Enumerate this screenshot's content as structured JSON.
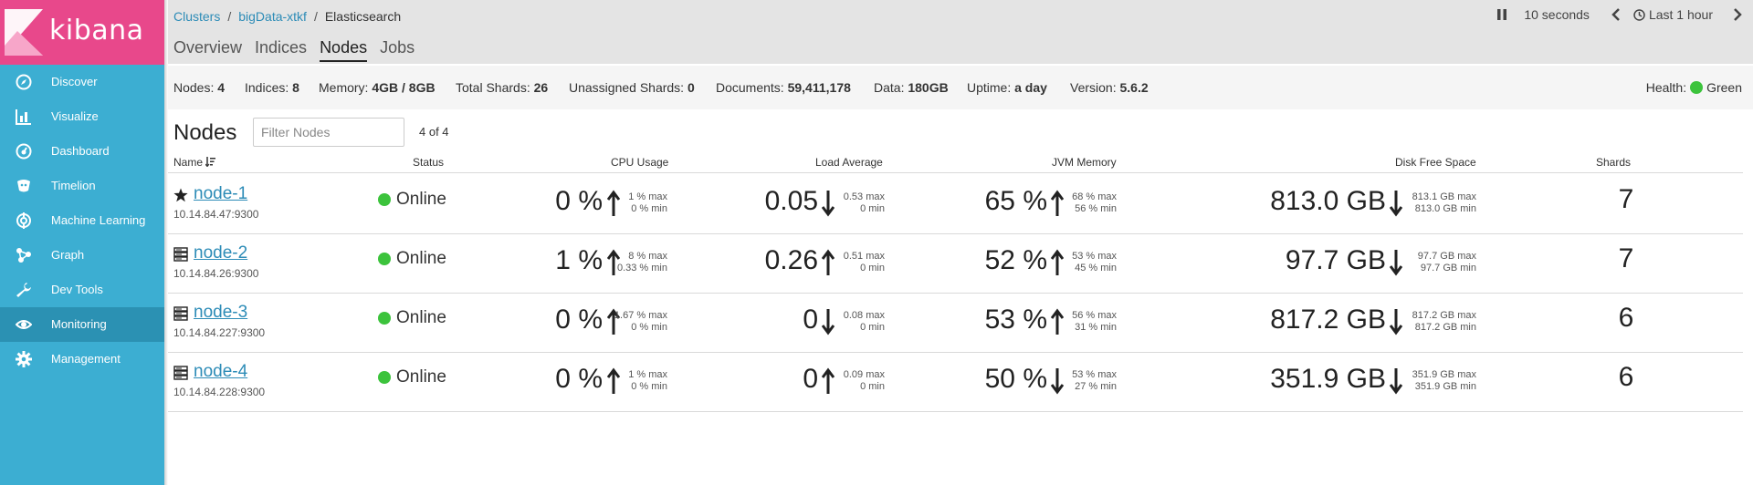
{
  "app": {
    "name": "kibana"
  },
  "sidebar": {
    "items": [
      {
        "label": "Discover",
        "icon": "compass-icon"
      },
      {
        "label": "Visualize",
        "icon": "bar-chart-icon"
      },
      {
        "label": "Dashboard",
        "icon": "dashboard-icon"
      },
      {
        "label": "Timelion",
        "icon": "timelion-icon"
      },
      {
        "label": "Machine Learning",
        "icon": "ml-icon"
      },
      {
        "label": "Graph",
        "icon": "graph-icon"
      },
      {
        "label": "Dev Tools",
        "icon": "wrench-icon"
      },
      {
        "label": "Monitoring",
        "icon": "eye-icon",
        "active": true
      },
      {
        "label": "Management",
        "icon": "gear-icon"
      }
    ]
  },
  "breadcrumb": {
    "root": "Clusters",
    "cluster": "bigData-xtkf",
    "current": "Elasticsearch",
    "sep": "/"
  },
  "tabs": [
    "Overview",
    "Indices",
    "Nodes",
    "Jobs"
  ],
  "time": {
    "interval": "10 seconds",
    "range": "Last 1 hour"
  },
  "summary": {
    "nodes_label": "Nodes:",
    "nodes": "4",
    "indices_label": "Indices:",
    "indices": "8",
    "memory_label": "Memory:",
    "memory": "4GB / 8GB",
    "shards_label": "Total Shards:",
    "shards": "26",
    "unassigned_label": "Unassigned Shards:",
    "unassigned": "0",
    "documents_label": "Documents:",
    "documents": "59,411,178",
    "data_label": "Data:",
    "data": "180GB",
    "uptime_label": "Uptime:",
    "uptime": "a day",
    "version_label": "Version:",
    "version": "5.6.2",
    "health_label": "Health:",
    "health": "Green"
  },
  "nodes_panel": {
    "title": "Nodes",
    "filter_placeholder": "Filter Nodes",
    "count": "4 of 4",
    "columns": {
      "name": "Name",
      "status": "Status",
      "cpu": "CPU Usage",
      "load": "Load Average",
      "jvm": "JVM Memory",
      "disk": "Disk Free Space",
      "shards": "Shards"
    },
    "rows": [
      {
        "name": "node-1",
        "ip": "10.14.84.47:9300",
        "icon": "star-icon",
        "status": "Online",
        "cpu": "0 %",
        "cpu_trend": "up",
        "cpu_max": "1 % max",
        "cpu_min": "0 % min",
        "load": "0.05",
        "load_trend": "down",
        "load_max": "0.53 max",
        "load_min": "0 min",
        "jvm": "65 %",
        "jvm_trend": "up",
        "jvm_max": "68 % max",
        "jvm_min": "56 % min",
        "disk": "813.0 GB",
        "disk_trend": "down",
        "disk_max": "813.1 GB max",
        "disk_min": "813.0 GB min",
        "shards": "7"
      },
      {
        "name": "node-2",
        "ip": "10.14.84.26:9300",
        "icon": "server-icon",
        "status": "Online",
        "cpu": "1 %",
        "cpu_trend": "up",
        "cpu_max": "8 % max",
        "cpu_min": "0.33 % min",
        "load": "0.26",
        "load_trend": "up",
        "load_max": "0.51 max",
        "load_min": "0 min",
        "jvm": "52 %",
        "jvm_trend": "up",
        "jvm_max": "53 % max",
        "jvm_min": "45 % min",
        "disk": "97.7 GB",
        "disk_trend": "down",
        "disk_max": "97.7 GB max",
        "disk_min": "97.7 GB min",
        "shards": "7"
      },
      {
        "name": "node-3",
        "ip": "10.14.84.227:9300",
        "icon": "server-icon",
        "status": "Online",
        "cpu": "0 %",
        "cpu_trend": "up",
        "cpu_max": "1.67 % max",
        "cpu_min": "0 % min",
        "load": "0",
        "load_trend": "down",
        "load_max": "0.08 max",
        "load_min": "0 min",
        "jvm": "53 %",
        "jvm_trend": "up",
        "jvm_max": "56 % max",
        "jvm_min": "31 % min",
        "disk": "817.2 GB",
        "disk_trend": "down",
        "disk_max": "817.2 GB max",
        "disk_min": "817.2 GB min",
        "shards": "6"
      },
      {
        "name": "node-4",
        "ip": "10.14.84.228:9300",
        "icon": "server-icon",
        "status": "Online",
        "cpu": "0 %",
        "cpu_trend": "up",
        "cpu_max": "1 % max",
        "cpu_min": "0 % min",
        "load": "0",
        "load_trend": "up",
        "load_max": "0.09 max",
        "load_min": "0 min",
        "jvm": "50 %",
        "jvm_trend": "down",
        "jvm_max": "53 % max",
        "jvm_min": "27 % min",
        "disk": "351.9 GB",
        "disk_trend": "down",
        "disk_max": "351.9 GB max",
        "disk_min": "351.9 GB min",
        "shards": "6"
      }
    ]
  },
  "colors": {
    "sidebar": "#3caed2",
    "logo_bg": "#e8488b",
    "link": "#2d8cb7",
    "online": "#3cc33c"
  }
}
